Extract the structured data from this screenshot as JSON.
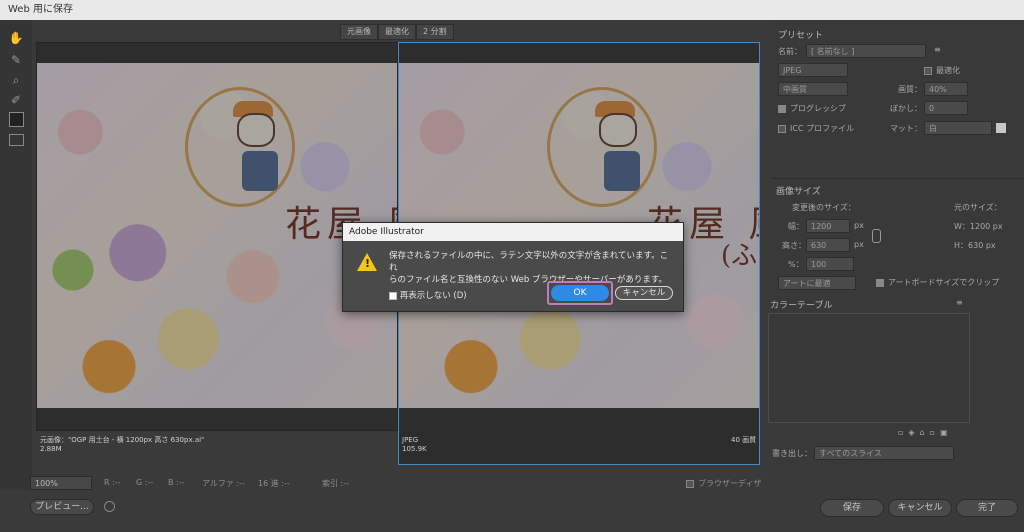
{
  "window": {
    "title": "Web 用に保存"
  },
  "tools": [
    {
      "name": "hand-tool-icon",
      "glyph": "✋"
    },
    {
      "name": "slice-select-tool-icon",
      "glyph": "✎"
    },
    {
      "name": "zoom-tool-icon",
      "glyph": "⌕"
    },
    {
      "name": "eyedropper-tool-icon",
      "glyph": "✐"
    }
  ],
  "view_tabs": [
    "元画像",
    "最適化",
    "2 分割"
  ],
  "left_pane": {
    "caption_line1": "元画像：\"OGP 用土台 - 横 1200px 高さ 630px.ai\"",
    "caption_line2": "2.88M"
  },
  "right_pane": {
    "format": "JPEG",
    "size": "105.9K",
    "quality_right": "40 画質"
  },
  "artwork": {
    "text_main": "花屋 風",
    "text_sub": "(ふ"
  },
  "bottom_bar": {
    "zoom": "100%",
    "r": "R :--",
    "g": "G :--",
    "b": "B :--",
    "alpha": "アルファ :--",
    "hex": "16 進 :--",
    "index": "索引 :--",
    "browser_dither": "ブラウザーディザ"
  },
  "buttons": {
    "preview": "プレビュー...",
    "save": "保存",
    "cancel": "キャンセル",
    "done": "完了"
  },
  "preset": {
    "section": "プリセット",
    "name_label": "名前：",
    "name_value": "[ 名前なし ]",
    "format": "JPEG",
    "optimize": "最適化",
    "quality_level": "中画質",
    "quality_label": "画質：",
    "quality_value": "40%",
    "progressive": "プログレッシブ",
    "blur_label": "ぼかし：",
    "blur_value": "0",
    "icc": "ICC プロファイル",
    "matte_label": "マット：",
    "matte_value": "白"
  },
  "image_size": {
    "section": "画像サイズ",
    "new_size": "変更後のサイズ：",
    "orig_size": "元のサイズ：",
    "width_label": "幅：",
    "width_value": "1200",
    "height_label": "高さ：",
    "height_value": "630",
    "px": "px",
    "orig_w": "W：1200 px",
    "orig_h": "H：630 px",
    "pct_label": "%：",
    "pct_value": "100",
    "fit": "アートに最適",
    "clip": "アートボードサイズでクリップ"
  },
  "color_table": {
    "section": "カラーテーブル"
  },
  "export": {
    "label": "書き出し：",
    "value": "すべてのスライス"
  },
  "dialog": {
    "title": "Adobe Illustrator",
    "message_line1": "保存されるファイルの中に、ラテン文字以外の文字が含まれています。これ",
    "message_line2": "らのファイル名と互換性のない Web ブラウザーやサーバーがあります。",
    "dont_show": "再表示しない (D)",
    "ok": "OK",
    "cancel": "キャンセル"
  }
}
